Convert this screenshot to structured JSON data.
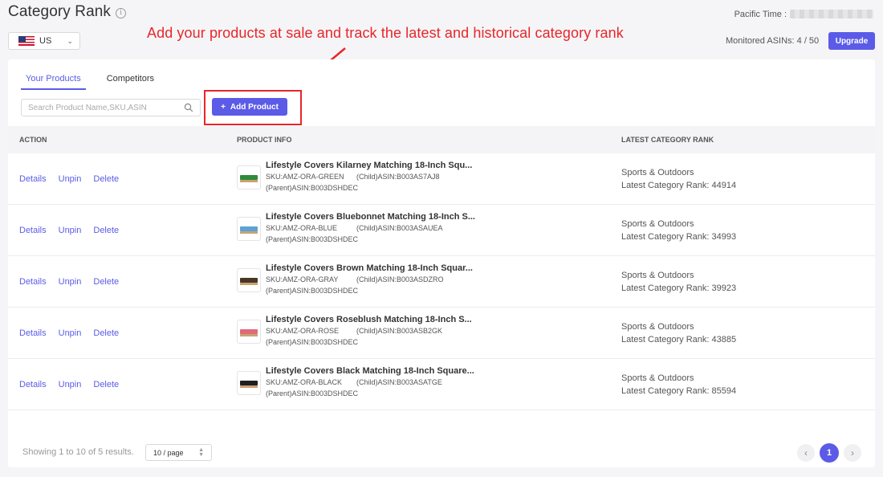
{
  "header": {
    "title": "Category Rank",
    "info_icon": "i",
    "country": "US",
    "pacific_time_label": "Pacific Time :",
    "monitored_label": "Monitored ASINs: 4 / 50",
    "upgrade_label": "Upgrade"
  },
  "annotation": {
    "text": "Add your products at sale and track the latest and historical category rank",
    "color": "#e8262a"
  },
  "tabs": [
    {
      "label": "Your Products",
      "active": true
    },
    {
      "label": "Competitors",
      "active": false
    }
  ],
  "search": {
    "placeholder": "Search Product Name,SKU,ASIN"
  },
  "add_product_label": "Add Product",
  "table": {
    "headers": {
      "action": "ACTION",
      "product": "PRODUCT INFO",
      "rank": "LATEST CATEGORY RANK"
    },
    "action_labels": {
      "details": "Details",
      "unpin": "Unpin",
      "delete": "Delete"
    },
    "rows": [
      {
        "title": "Lifestyle Covers Kilarney Matching 18-Inch Squ...",
        "sku": "SKU:AMZ-ORA-GREEN",
        "child": "(Child)ASIN:B003AS7AJ8",
        "parent": "(Parent)ASIN:B003DSHDEC",
        "category": "Sports & Outdoors",
        "rank": "Latest Category Rank: 44914",
        "swatch": "#2f8a3a"
      },
      {
        "title": "Lifestyle Covers Bluebonnet Matching 18-Inch S...",
        "sku": "SKU:AMZ-ORA-BLUE",
        "child": "(Child)ASIN:B003ASAUEA",
        "parent": "(Parent)ASIN:B003DSHDEC",
        "category": "Sports & Outdoors",
        "rank": "Latest Category Rank: 34993",
        "swatch": "#5aa2d8"
      },
      {
        "title": "Lifestyle Covers Brown Matching 18-Inch Squar...",
        "sku": "SKU:AMZ-ORA-GRAY",
        "child": "(Child)ASIN:B003ASDZRO",
        "parent": "(Parent)ASIN:B003DSHDEC",
        "category": "Sports & Outdoors",
        "rank": "Latest Category Rank: 39923",
        "swatch": "#4a3526"
      },
      {
        "title": "Lifestyle Covers Roseblush Matching 18-Inch S...",
        "sku": "SKU:AMZ-ORA-ROSE",
        "child": "(Child)ASIN:B003ASB2GK",
        "parent": "(Parent)ASIN:B003DSHDEC",
        "category": "Sports & Outdoors",
        "rank": "Latest Category Rank: 43885",
        "swatch": "#e06a78"
      },
      {
        "title": "Lifestyle Covers Black Matching 18-Inch Square...",
        "sku": "SKU:AMZ-ORA-BLACK",
        "child": "(Child)ASIN:B003ASATGE",
        "parent": "(Parent)ASIN:B003DSHDEC",
        "category": "Sports & Outdoors",
        "rank": "Latest Category Rank: 85594",
        "swatch": "#1f1f1f"
      }
    ]
  },
  "footer": {
    "results_text": "Showing 1 to 10 of 5 results.",
    "page_size": "10 / page",
    "current_page": "1"
  },
  "colors": {
    "accent": "#5b5be8",
    "annotation_red": "#e8262a"
  }
}
